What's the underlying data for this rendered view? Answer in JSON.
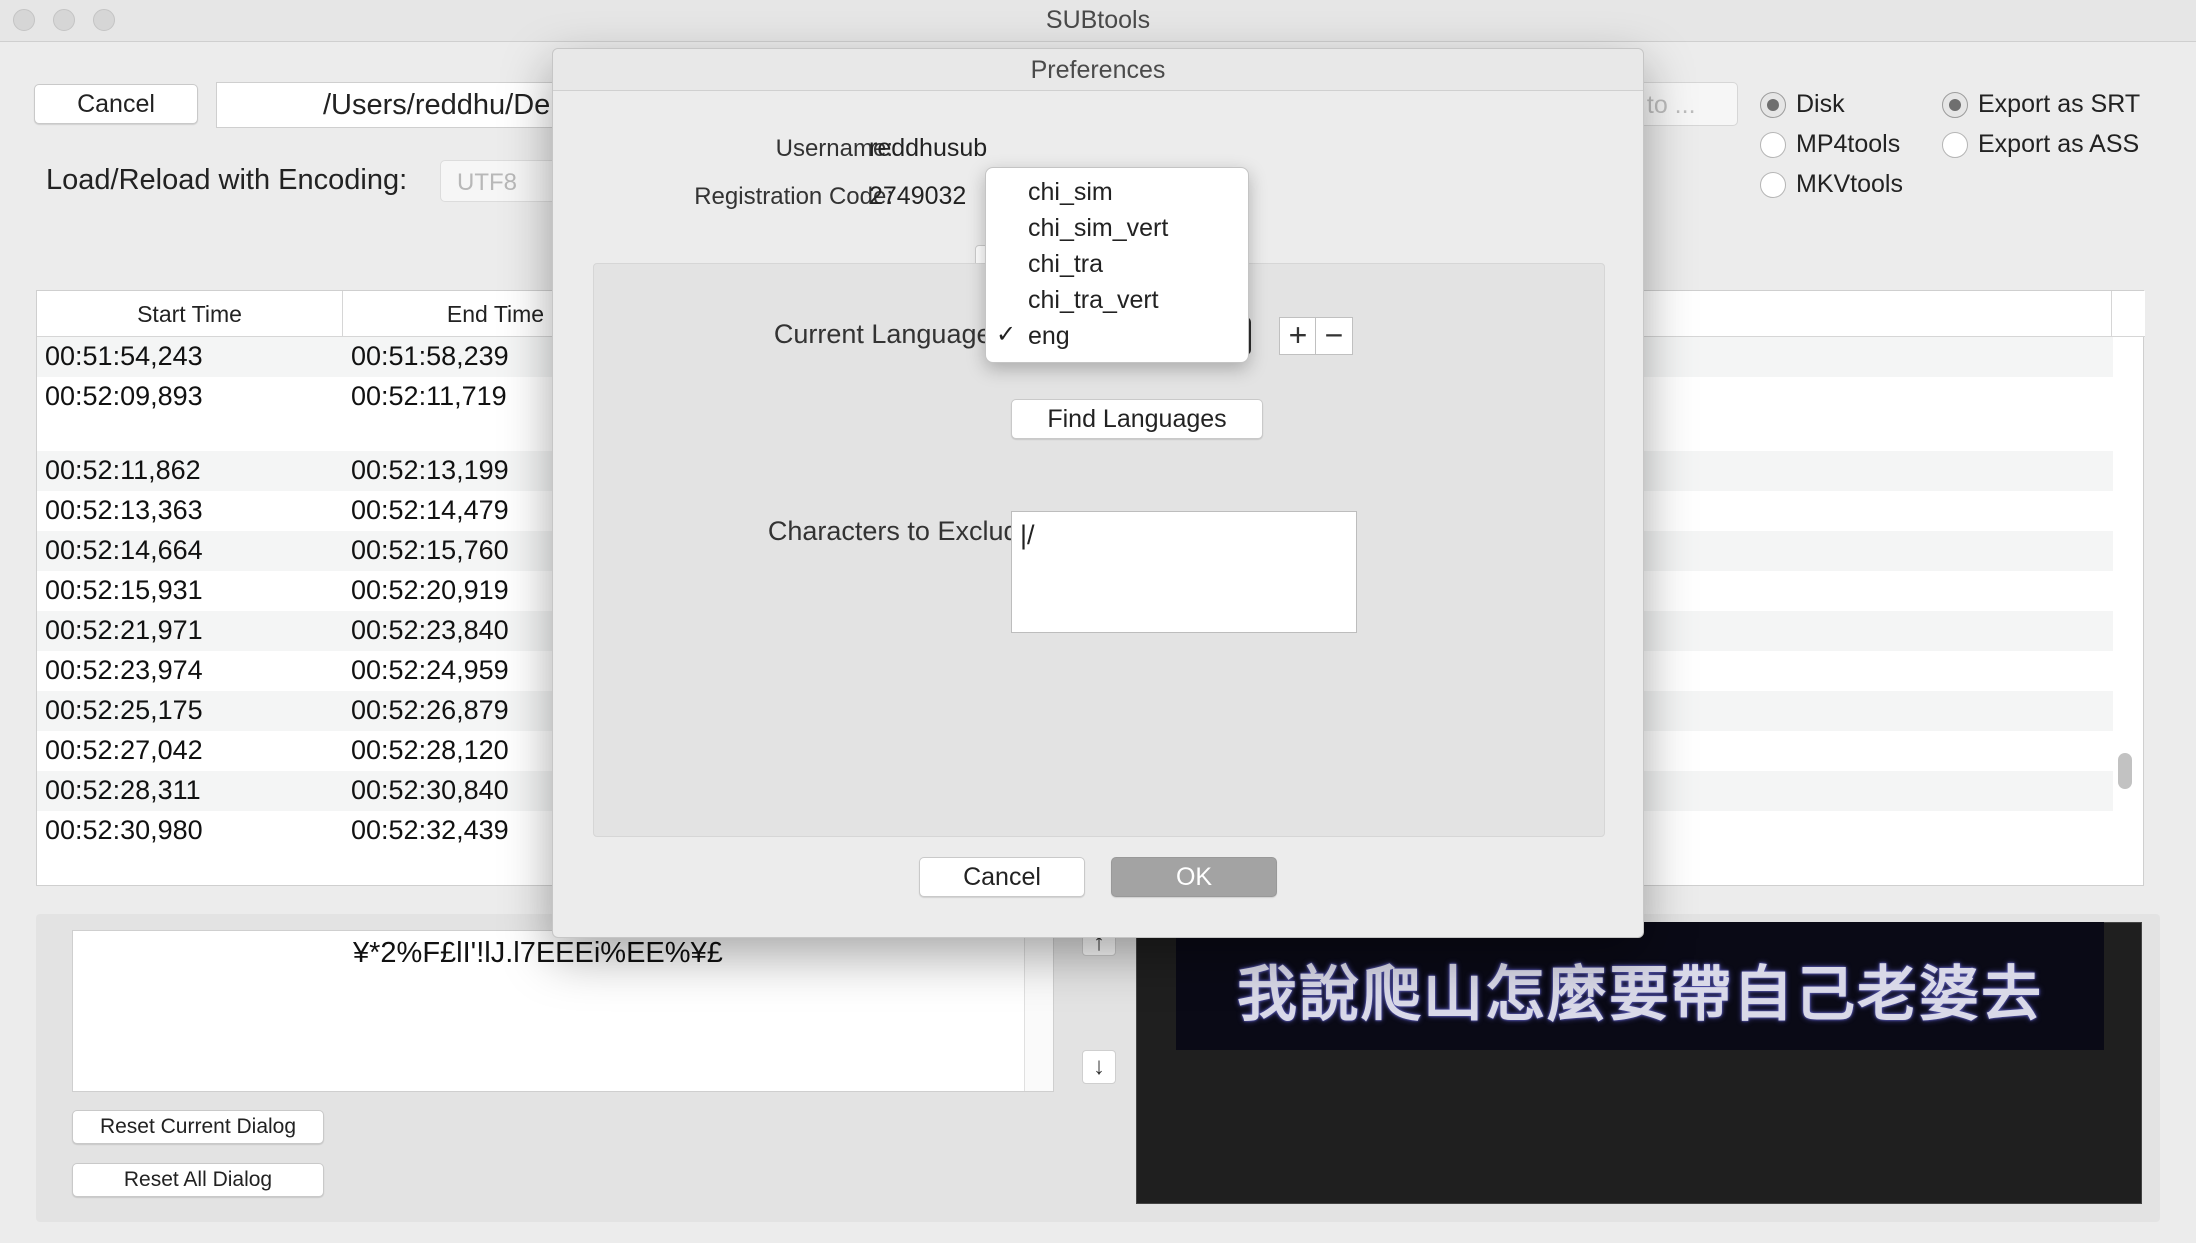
{
  "window": {
    "title": "SUBtools"
  },
  "toolbar": {
    "cancel_label": "Cancel",
    "path_value": "/Users/reddhu/De",
    "export_label": "t to ...",
    "encoding_label": "Load/Reload with Encoding:",
    "encoding_value": "UTF8"
  },
  "output_options": [
    {
      "label": "Disk",
      "selected": true
    },
    {
      "label": "MP4tools",
      "selected": false
    },
    {
      "label": "MKVtools",
      "selected": false
    }
  ],
  "format_options": [
    {
      "label": "Export as SRT",
      "selected": true
    },
    {
      "label": "Export as ASS",
      "selected": false
    }
  ],
  "table": {
    "columns": [
      "Start Time",
      "End Time"
    ],
    "rows": [
      {
        "start": "00:51:54,243",
        "end": "00:51:58,239"
      },
      {
        "start": "00:52:09,893",
        "end": "00:52:11,719"
      },
      {
        "start": "00:52:11,862",
        "end": "00:52:13,199"
      },
      {
        "start": "00:52:13,363",
        "end": "00:52:14,479"
      },
      {
        "start": "00:52:14,664",
        "end": "00:52:15,760"
      },
      {
        "start": "00:52:15,931",
        "end": "00:52:20,919"
      },
      {
        "start": "00:52:21,971",
        "end": "00:52:23,840"
      },
      {
        "start": "00:52:23,974",
        "end": "00:52:24,959"
      },
      {
        "start": "00:52:25,175",
        "end": "00:52:26,879"
      },
      {
        "start": "00:52:27,042",
        "end": "00:52:28,120"
      },
      {
        "start": "00:52:28,311",
        "end": "00:52:30,840"
      },
      {
        "start": "00:52:30,980",
        "end": "00:52:32,439"
      }
    ]
  },
  "editor": {
    "dialog_text": "¥*2%F£lI'!lJ.l7EEEi%EE%¥£",
    "up_arrow": "↑",
    "down_arrow": "↓",
    "reset_current_label": "Reset Current Dialog",
    "reset_all_label": "Reset All Dialog"
  },
  "preview": {
    "subtitle_text": "我說爬山怎麼要帶自己老婆去"
  },
  "preferences": {
    "title": "Preferences",
    "username_label": "Username:",
    "username_value": "reddhusub",
    "regcode_label": "Registration Code:",
    "regcode_value": "2749032",
    "current_language_label": "Current Language:",
    "plus_label": "+",
    "minus_label": "−",
    "find_languages_label": "Find Languages",
    "exclude_label": "Characters to Exclude:",
    "exclude_value": "|/",
    "cancel_label": "Cancel",
    "ok_label": "OK",
    "language_menu": [
      "chi_sim",
      "chi_sim_vert",
      "chi_tra",
      "chi_tra_vert",
      "eng"
    ],
    "selected_language": "eng",
    "check_mark": "✓"
  }
}
